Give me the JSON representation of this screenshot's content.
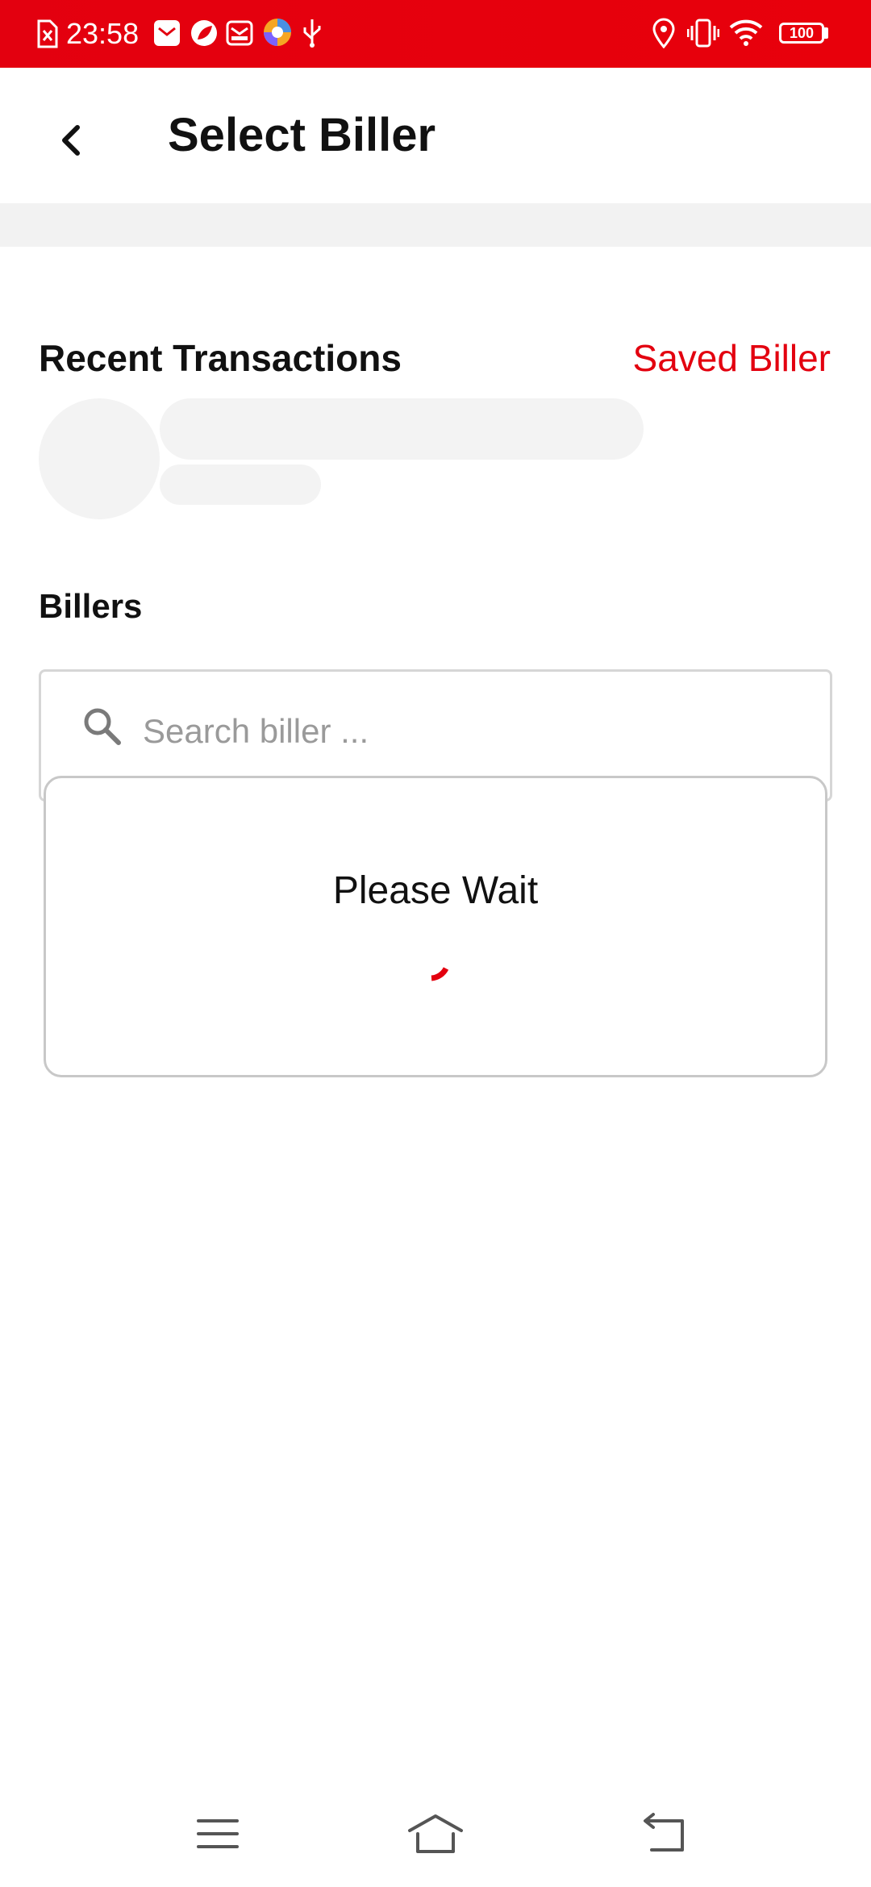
{
  "status_bar": {
    "time": "23:58",
    "battery": "100",
    "icons": [
      "sim-error-icon",
      "mail-icon",
      "leaf-app-icon",
      "inbox-icon",
      "browser-icon",
      "usb-icon",
      "location-icon",
      "vibrate-icon",
      "wifi-icon",
      "battery-icon"
    ]
  },
  "header": {
    "title": "Select Biller",
    "back_icon": "chevron-left-icon"
  },
  "recent": {
    "title": "Recent Transactions",
    "saved_link": "Saved Biller"
  },
  "billers": {
    "title": "Billers",
    "search_placeholder": "Search biller ...",
    "search_value": ""
  },
  "dialog": {
    "message": "Please Wait"
  },
  "nav": {
    "items": [
      "menu-icon",
      "home-icon",
      "back-icon"
    ]
  },
  "colors": {
    "accent": "#e3000f",
    "skeleton": "#f3f3f3",
    "band": "#f2f2f2"
  }
}
